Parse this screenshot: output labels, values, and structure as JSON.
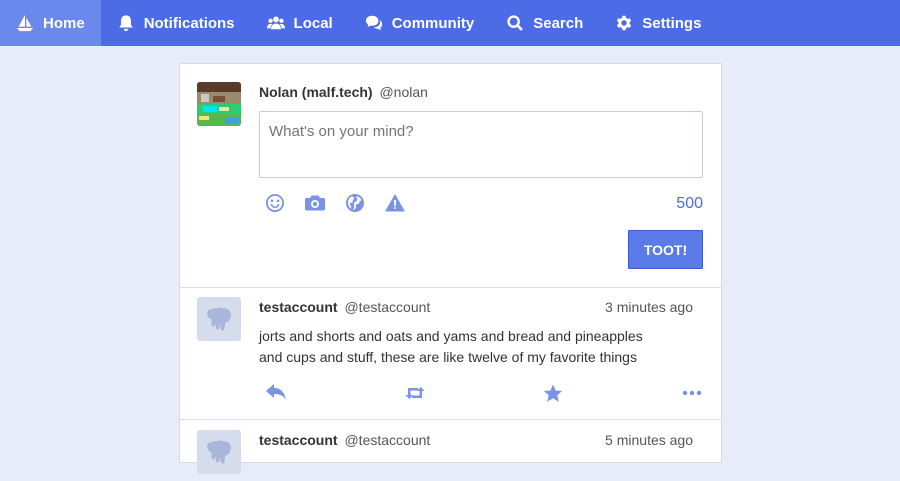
{
  "nav": {
    "items": [
      {
        "label": "Home",
        "icon": "sailboat-icon",
        "active": true
      },
      {
        "label": "Notifications",
        "icon": "bell-icon"
      },
      {
        "label": "Local",
        "icon": "users-icon"
      },
      {
        "label": "Community",
        "icon": "comments-icon"
      },
      {
        "label": "Search",
        "icon": "search-icon"
      },
      {
        "label": "Settings",
        "icon": "gear-icon"
      }
    ]
  },
  "compose": {
    "name": "Nolan (malf.tech)",
    "handle": "@nolan",
    "placeholder": "What's on your mind?",
    "value": "",
    "tools": [
      "emoji-icon",
      "camera-icon",
      "globe-icon",
      "warning-icon"
    ],
    "char_count": "500",
    "submit_label": "TOOT!"
  },
  "statuses": [
    {
      "name": "testaccount",
      "handle": "@testaccount",
      "time": "3 minutes ago",
      "text_line1": "jorts and shorts and oats and yams and bread and pineapples",
      "text_line2": "and cups and stuff, these are like twelve of my favorite things"
    },
    {
      "name": "testaccount",
      "handle": "@testaccount",
      "time": "5 minutes ago"
    }
  ],
  "colors": {
    "accent": "#4b6ce6",
    "background": "#e8ebf8",
    "icon": "#7a93e8"
  }
}
